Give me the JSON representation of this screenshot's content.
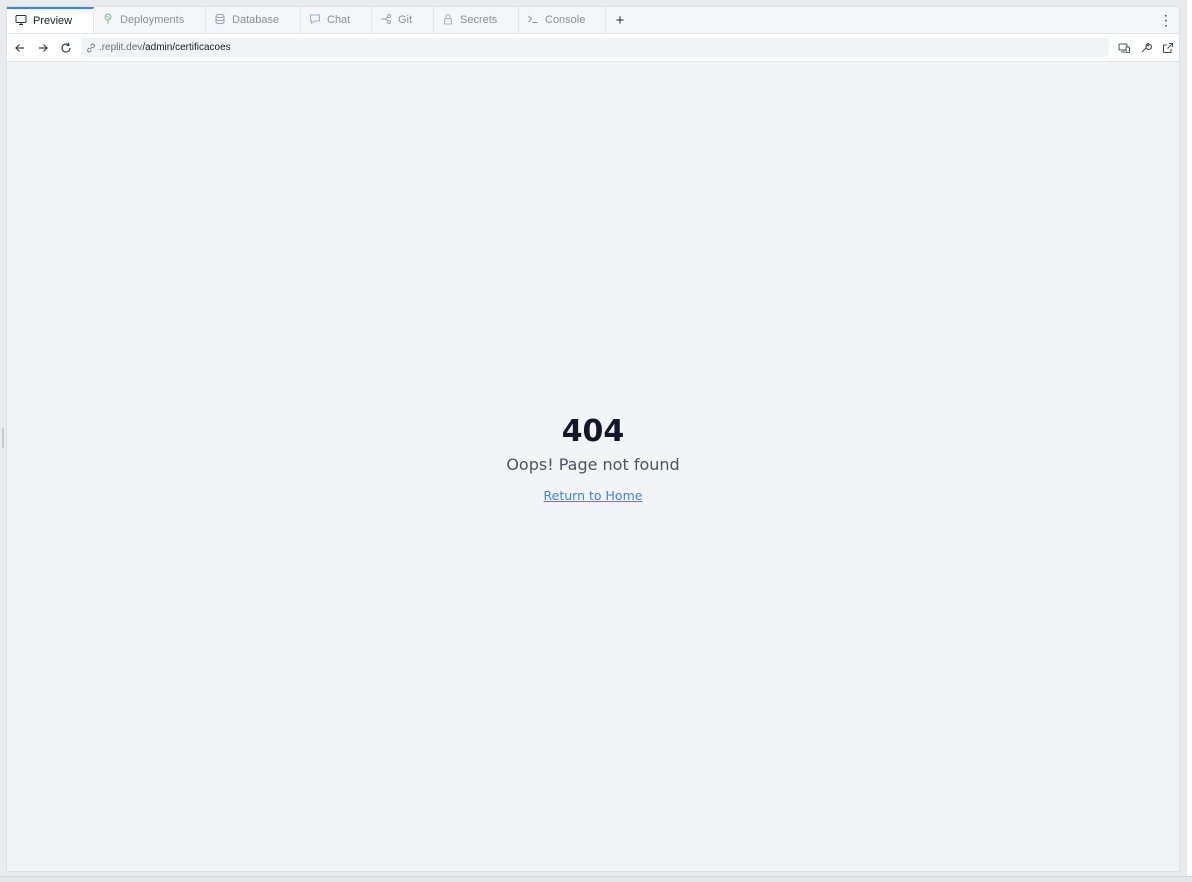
{
  "tabs": [
    {
      "id": "preview",
      "label": "Preview",
      "icon": "monitor-icon",
      "active": true
    },
    {
      "id": "deployments",
      "label": "Deployments",
      "icon": "deployments-icon"
    },
    {
      "id": "database",
      "label": "Database",
      "icon": "database-icon"
    },
    {
      "id": "chat",
      "label": "Chat",
      "icon": "chat-icon"
    },
    {
      "id": "git",
      "label": "Git",
      "icon": "git-icon"
    },
    {
      "id": "secrets",
      "label": "Secrets",
      "icon": "lock-icon"
    },
    {
      "id": "console",
      "label": "Console",
      "icon": "terminal-icon"
    }
  ],
  "tabbar": {
    "add_label": "+",
    "menu_label": "⋮"
  },
  "addressbar": {
    "url_host": ".replit.dev",
    "url_path": "/admin/certificacoes"
  },
  "page": {
    "code": "404",
    "message": "Oops! Page not found",
    "link_label": "Return to Home"
  },
  "colors": {
    "accent": "#3b82f6",
    "background": "#f3f4f6",
    "heading": "#111827"
  }
}
